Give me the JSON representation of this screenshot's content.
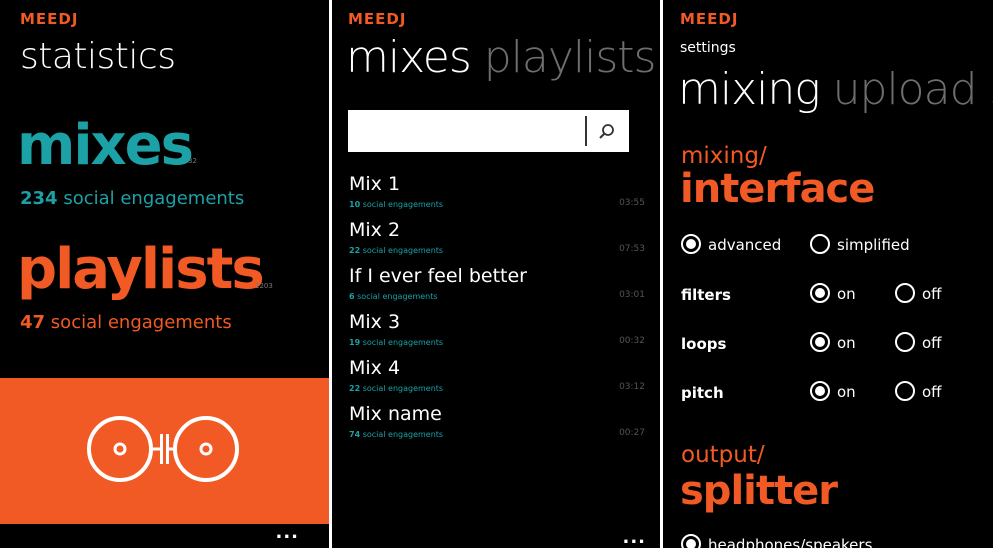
{
  "brand": {
    "logo": "MEEDJ"
  },
  "panel1": {
    "title": "statistics",
    "mixes": {
      "label": "mixes",
      "count": "32",
      "engagement_number": "234",
      "engagement_text": "social engagements"
    },
    "playlists": {
      "label": "playlists",
      "count": "1203",
      "engagement_number": "47",
      "engagement_text": "social engagements"
    },
    "tile_icon": "turntables-logo-icon",
    "more": "..."
  },
  "panel2": {
    "pivot": {
      "active": "mixes",
      "next": "playlists",
      "peek": "s"
    },
    "search": {
      "value": "",
      "placeholder": ""
    },
    "mixes": [
      {
        "name": "Mix 1",
        "engagement_number": "10",
        "engagement_text": "social engagements",
        "duration": "03:55"
      },
      {
        "name": "Mix 2",
        "engagement_number": "22",
        "engagement_text": "social engagements",
        "duration": "07:53"
      },
      {
        "name": "If I ever feel better",
        "engagement_number": "6",
        "engagement_text": "social engagements",
        "duration": "03:01"
      },
      {
        "name": "Mix 3",
        "engagement_number": "19",
        "engagement_text": "social engagements",
        "duration": "00:32"
      },
      {
        "name": "Mix 4",
        "engagement_number": "22",
        "engagement_text": "social engagements",
        "duration": "03:12"
      },
      {
        "name": "Mix name",
        "engagement_number": "74",
        "engagement_text": "social engagements",
        "duration": "00:27"
      }
    ],
    "more": "..."
  },
  "panel3": {
    "header": "settings",
    "pivot": {
      "active": "mixing",
      "next": "upload",
      "peek": "s"
    },
    "interface": {
      "sub": "mixing/",
      "head": "interface",
      "options": [
        {
          "label": "advanced",
          "selected": true
        },
        {
          "label": "simplified",
          "selected": false
        }
      ]
    },
    "toggles": [
      {
        "label": "filters",
        "on": "on",
        "off": "off",
        "value": "on"
      },
      {
        "label": "loops",
        "on": "on",
        "off": "off",
        "value": "on"
      },
      {
        "label": "pitch",
        "on": "on",
        "off": "off",
        "value": "on"
      }
    ],
    "output": {
      "sub": "output/",
      "head": "splitter",
      "first_option": "headphones/speakers"
    }
  },
  "colors": {
    "accent_orange": "#f15a24",
    "accent_teal": "#1ba1a6",
    "background": "#000000"
  }
}
